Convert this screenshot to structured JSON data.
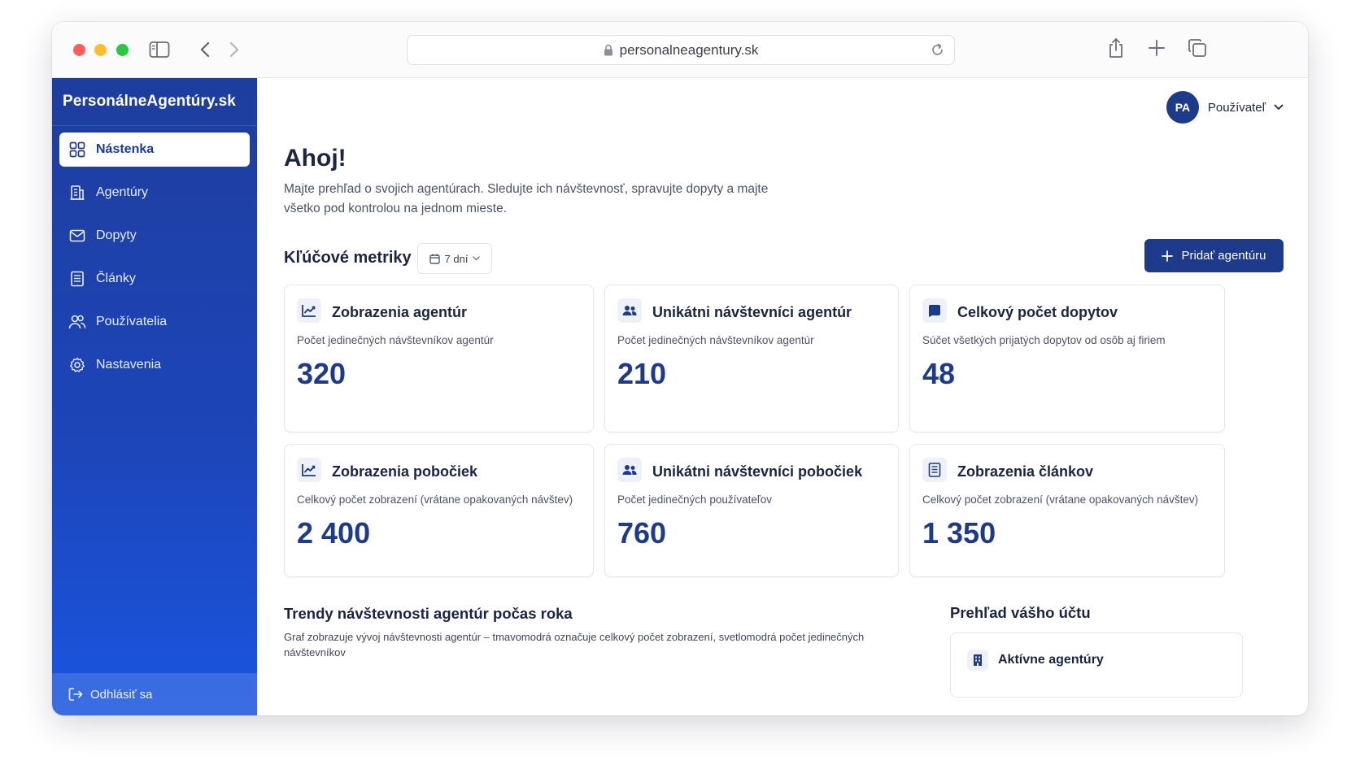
{
  "browser": {
    "url": "personalneagentury.sk"
  },
  "sidebar": {
    "brand": "PersonálneAgentúry.sk",
    "items": [
      {
        "label": "Nástenka",
        "icon": "dashboard-icon",
        "active": true
      },
      {
        "label": "Agentúry",
        "icon": "building-icon",
        "active": false
      },
      {
        "label": "Dopyty",
        "icon": "mail-icon",
        "active": false
      },
      {
        "label": "Články",
        "icon": "article-icon",
        "active": false
      },
      {
        "label": "Používatelia",
        "icon": "users-icon",
        "active": false
      },
      {
        "label": "Nastavenia",
        "icon": "gear-icon",
        "active": false
      }
    ],
    "logout": "Odhlásiť sa"
  },
  "header": {
    "avatar_initials": "PA",
    "user_label": "Používateľ"
  },
  "main": {
    "greeting": "Ahoj!",
    "intro": "Majte prehľad o svojich agentúrach. Sledujte ich návštevnosť, spravujte dopyty a majte všetko pod kontrolou na jednom mieste.",
    "metrics_title": "Kľúčové metriky",
    "range": "7 dní",
    "add_button": "Pridať agentúru",
    "cards": [
      {
        "icon": "trend-chart-icon",
        "title": "Zobrazenia agentúr",
        "desc": "Počet jedinečných návštevníkov agentúr",
        "value": "320"
      },
      {
        "icon": "users-icon",
        "title": "Unikátni návštevníci agentúr",
        "desc": "Počet jedinečných návštevníkov agentúr",
        "value": "210"
      },
      {
        "icon": "message-icon",
        "title": "Celkový počet dopytov",
        "desc": "Súčet všetkých prijatých dopytov od osôb aj firiem",
        "value": "48"
      },
      {
        "icon": "trend-chart-icon",
        "title": "Zobrazenia pobočiek",
        "desc": "Celkový počet zobrazení (vrátane opakovaných návštev)",
        "value": "2 400"
      },
      {
        "icon": "users-icon",
        "title": "Unikátni návštevníci pobočiek",
        "desc": "Počet jedinečných používateľov",
        "value": "760"
      },
      {
        "icon": "article-icon",
        "title": "Zobrazenia článkov",
        "desc": "Celkový počet zobrazení (vrátane opakovaných návštev)",
        "value": "1 350"
      }
    ],
    "trend_title": "Trendy návštevnosti agentúr počas roka",
    "trend_desc": "Graf zobrazuje vývoj návštevnosti agentúr – tmavomodrá označuje celkový počet zobrazení, svetlomodrá počet jedinečných návštevníkov",
    "account_title": "Prehľad vášho účtu",
    "account_items": [
      {
        "icon": "building-icon",
        "label": "Aktívne agentúry"
      }
    ]
  },
  "colors": {
    "primary": "#1e3a8a",
    "sidebar_top": "#1e3e9e",
    "sidebar_bottom": "#1a55e0"
  }
}
